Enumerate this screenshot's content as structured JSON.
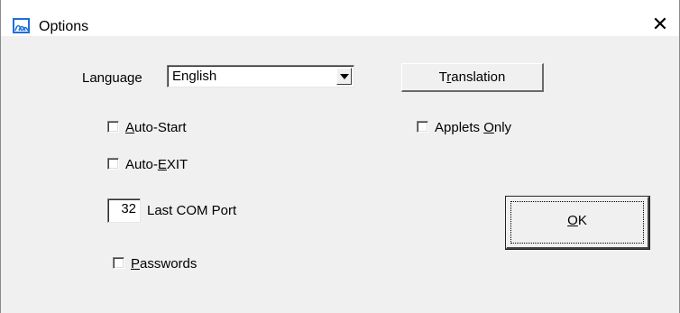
{
  "window": {
    "title": "Options",
    "app_icon": "signal-waves-icon",
    "close_glyph": "✕"
  },
  "language": {
    "label": "Language",
    "selected": "English"
  },
  "translation_button": {
    "pre": "T",
    "accel": "r",
    "post": "anslation"
  },
  "auto_start": {
    "pre": "",
    "accel": "A",
    "post": "uto-Start",
    "checked": false
  },
  "auto_exit": {
    "pre": "Auto-",
    "accel": "E",
    "post": "XIT",
    "checked": false
  },
  "applets_only": {
    "pre": "Applets ",
    "accel": "O",
    "post": "nly",
    "checked": false
  },
  "com_port": {
    "value": "32",
    "label": "Last COM Port"
  },
  "passwords": {
    "pre": "",
    "accel": "P",
    "post": "asswords",
    "checked": false
  },
  "ok_button": {
    "pre": "",
    "accel": "O",
    "post": "K"
  },
  "colors": {
    "accent": "#1e6fd9",
    "background": "#f0f0f0",
    "titlebar": "#ffffff"
  }
}
